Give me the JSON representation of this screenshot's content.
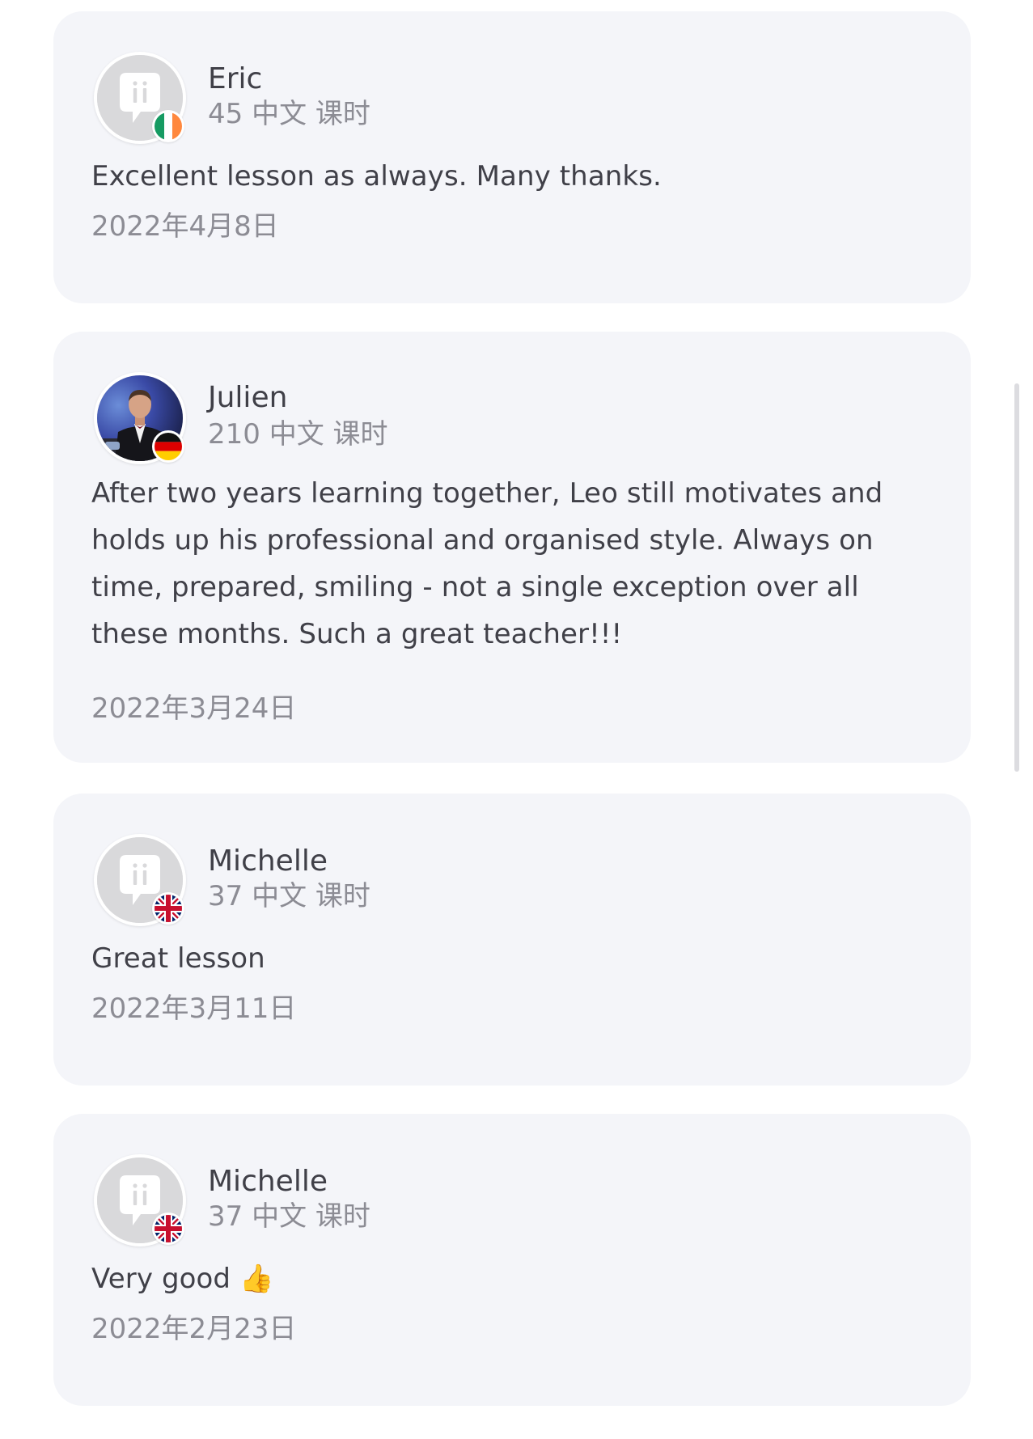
{
  "reviews": [
    {
      "name": "Eric",
      "lessons": "45 中文 课时",
      "text": "Excellent lesson as always.  Many thanks.",
      "date": "2022年4月8日",
      "avatar": "default-avatar",
      "flag": "ireland-flag"
    },
    {
      "name": "Julien",
      "lessons": "210 中文 课时",
      "text": "After two years learning together, Leo still motivates and holds up his professional and organised style. Always on time, prepared, smiling - not a single exception over all these months. Such a great teacher!!!",
      "date": "2022年3月24日",
      "avatar": "photo-avatar",
      "flag": "germany-flag"
    },
    {
      "name": "Michelle",
      "lessons": "37 中文 课时",
      "text": "Great lesson",
      "date": "2022年3月11日",
      "avatar": "default-avatar",
      "flag": "uk-flag"
    },
    {
      "name": "Michelle",
      "lessons": "37 中文 课时",
      "text": "Very good 👍",
      "date": "2022年2月23日",
      "avatar": "default-avatar",
      "flag": "uk-flag"
    }
  ],
  "colors": {
    "card_background": "#f4f5f9",
    "primary_text": "#404048",
    "secondary_text": "#8c8c94",
    "placeholder_avatar": "#d9d9db"
  }
}
